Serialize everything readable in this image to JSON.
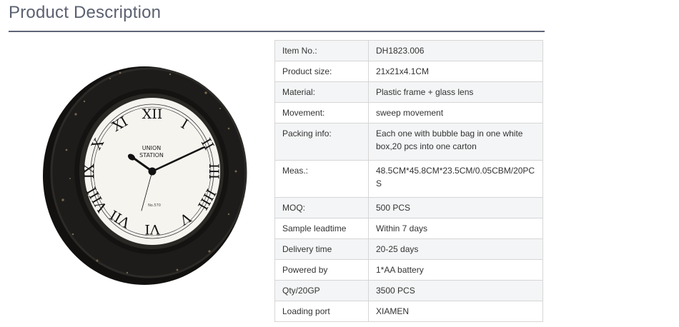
{
  "section": {
    "title": "Product Description"
  },
  "clock_image": {
    "brand_line1": "UNION",
    "brand_line2": "STATION",
    "model_mark": "No.570",
    "frame_color": "#1b1a18",
    "dial_color": "#f6f4ef"
  },
  "specs": [
    {
      "label": "Item No.:",
      "value": "DH1823.006"
    },
    {
      "label": "Product size:",
      "value": "21x21x4.1CM"
    },
    {
      "label": "Material:",
      "value": "Plastic frame + glass lens"
    },
    {
      "label": "Movement:",
      "value": "sweep movement"
    },
    {
      "label": "Packing info:",
      "value": "Each one with bubble bag in one white box,20 pcs into one carton"
    },
    {
      "label": "Meas.:",
      "value": "48.5CM*45.8CM*23.5CM/0.05CBM/20PCS"
    },
    {
      "label": "MOQ:",
      "value": "500 PCS"
    },
    {
      "label": "Sample leadtime",
      "value": "Within 7 days"
    },
    {
      "label": "Delivery time",
      "value": "20-25 days"
    },
    {
      "label": "Powered by",
      "value": "1*AA battery"
    },
    {
      "label": "Qty/20GP",
      "value": "3500 PCS"
    },
    {
      "label": "Loading port",
      "value": "XIAMEN"
    }
  ]
}
